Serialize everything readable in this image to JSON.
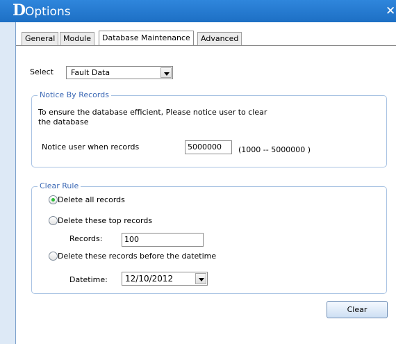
{
  "window": {
    "title": "Options",
    "logo_letter": "D",
    "close_glyph": "✕"
  },
  "tabs": [
    {
      "label": "General"
    },
    {
      "label": "Module"
    },
    {
      "label": "Database Maintenance",
      "active": true
    },
    {
      "label": "Advanced"
    }
  ],
  "select": {
    "label": "Select",
    "value": "Fault Data"
  },
  "notice": {
    "legend": "Notice By Records",
    "line1": "To ensure the database efficient, Please  notice user to clear",
    "line2": "the database",
    "records_label": "Notice user when records",
    "records_value": "5000000",
    "range_hint": "(1000 -- 5000000 )"
  },
  "clear_rule": {
    "legend": "Clear Rule",
    "options": [
      {
        "label": "Delete all records",
        "checked": true
      },
      {
        "label": "Delete these top records",
        "checked": false
      },
      {
        "label": "Delete these records before the datetime",
        "checked": false
      }
    ],
    "records_label": "Records:",
    "records_value": "100",
    "datetime_label": "Datetime:",
    "datetime_value": "12/10/2012"
  },
  "clear_button": {
    "label": "Clear"
  }
}
